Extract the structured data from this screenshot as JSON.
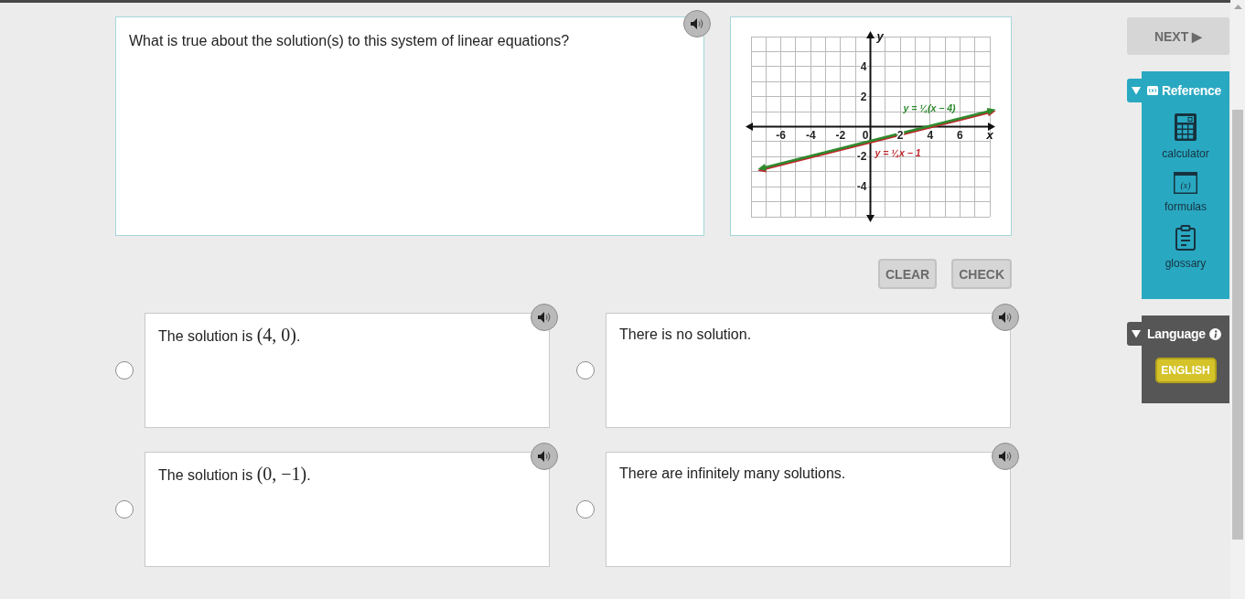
{
  "question": {
    "text": "What is true about the solution(s) to this system of linear equations?"
  },
  "graph": {
    "axes": {
      "x_label": "x",
      "y_label": "y",
      "x_ticks": [
        "-6",
        "-4",
        "-2",
        "0",
        "2",
        "4",
        "6"
      ],
      "y_ticks": [
        "4",
        "2",
        "-2",
        "-4"
      ]
    },
    "lines": [
      {
        "label": "y = ¼x − 1",
        "color": "#c0282d"
      },
      {
        "label": "y = ¼(x − 4)",
        "color": "#2e8b2e"
      }
    ]
  },
  "actions": [
    {
      "label": "CLEAR",
      "disabled": true
    },
    {
      "label": "CHECK",
      "disabled": true
    }
  ],
  "choices": [
    {
      "text": "The solution is",
      "math": "(4, 0)",
      "after": ".",
      "selected": false
    },
    {
      "text": "There is no solution.",
      "selected": false
    },
    {
      "text": "The solution is",
      "math": "(0, −1)",
      "after": ".",
      "selected": false
    },
    {
      "text": "There are infinitely many solutions.",
      "selected": false
    }
  ],
  "sidebar": {
    "next": {
      "label": "NEXT ▶",
      "disabled": true
    },
    "reference": {
      "title": "Reference",
      "expanded": true,
      "tools": [
        {
          "kind": "calculator",
          "label": "calculator"
        },
        {
          "kind": "formulas",
          "label": "formulas",
          "glyph": "(x)"
        },
        {
          "kind": "glossary",
          "label": "glossary"
        }
      ]
    },
    "language": {
      "title": "Language",
      "expanded": true,
      "options": [
        {
          "label": "ENGLISH",
          "selected": true
        }
      ]
    }
  }
}
